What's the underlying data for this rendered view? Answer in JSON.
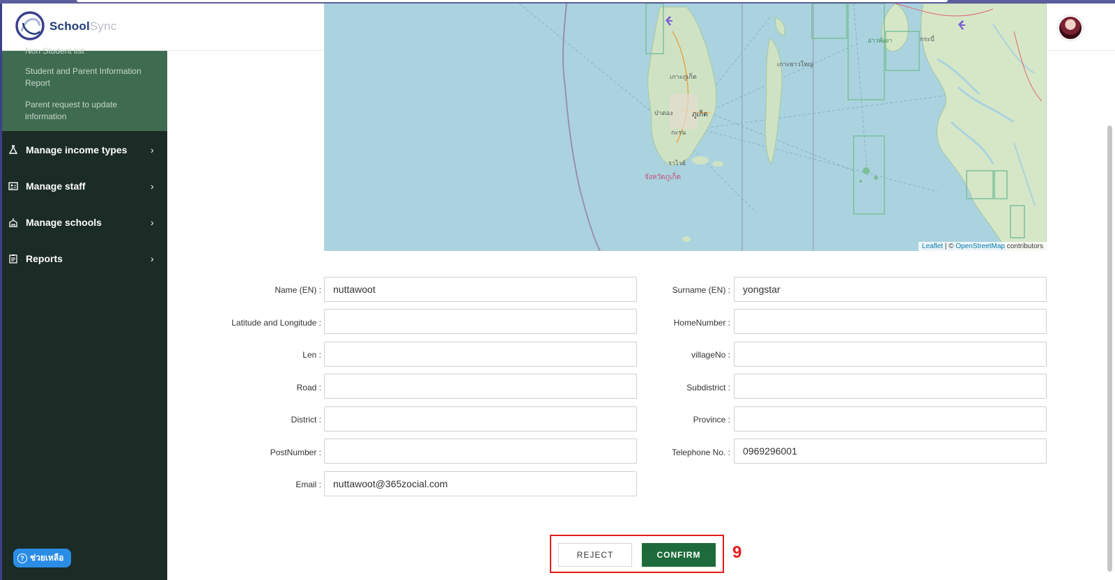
{
  "app": {
    "brand_main": "School",
    "brand_sub": "Sync"
  },
  "sidebar": {
    "submenu_items": [
      {
        "label": "Non Student list"
      },
      {
        "label": "Student and Parent Information Report"
      },
      {
        "label": "Parent request to update information"
      }
    ],
    "menu": [
      {
        "label": "Manage income types",
        "icon": "flask-icon"
      },
      {
        "label": "Manage staff",
        "icon": "id-card-icon"
      },
      {
        "label": "Manage schools",
        "icon": "school-icon"
      },
      {
        "label": "Reports",
        "icon": "clipboard-icon"
      }
    ],
    "help_label": "ช่วยเหลือ"
  },
  "map": {
    "attribution_leaflet": "Leaflet",
    "attribution_sep": "| ©",
    "attribution_osm": "OpenStreetMap",
    "attribution_tail": "contributors",
    "labels": [
      "เกาะภูเก็ต",
      "ภูเก็ต",
      "จังหวัดภูเก็ต",
      "ราไวย์",
      "ป่าตอง",
      "กะรน",
      "กระบี่",
      "เกาะยาวใหญ่",
      "อ่าวพังงา"
    ]
  },
  "form": {
    "left": [
      {
        "label": "Name (EN) :",
        "value": "nuttawoot"
      },
      {
        "label": "Latitude and Longitude :",
        "value": ""
      },
      {
        "label": "Len :",
        "value": ""
      },
      {
        "label": "Road :",
        "value": ""
      },
      {
        "label": "District :",
        "value": ""
      },
      {
        "label": "PostNumber :",
        "value": ""
      },
      {
        "label": "Email :",
        "value": "nuttawoot@365zocial.com"
      }
    ],
    "right": [
      {
        "label": "Surname (EN) :",
        "value": "yongstar"
      },
      {
        "label": "HomeNumber :",
        "value": ""
      },
      {
        "label": "villageNo :",
        "value": ""
      },
      {
        "label": "Subdistrict :",
        "value": ""
      },
      {
        "label": "Province :",
        "value": ""
      },
      {
        "label": "Telephone No. :",
        "value": "0969296001"
      }
    ]
  },
  "actions": {
    "reject_label": "REJECT",
    "confirm_label": "CONFIRM",
    "step_number": "9"
  },
  "colors": {
    "sidebar_bg": "#1b2b26",
    "submenu_bg": "#3f6b50",
    "confirm_bg": "#1d6b3a",
    "highlight_red": "#e41c1c",
    "map_water": "#aad3df"
  }
}
